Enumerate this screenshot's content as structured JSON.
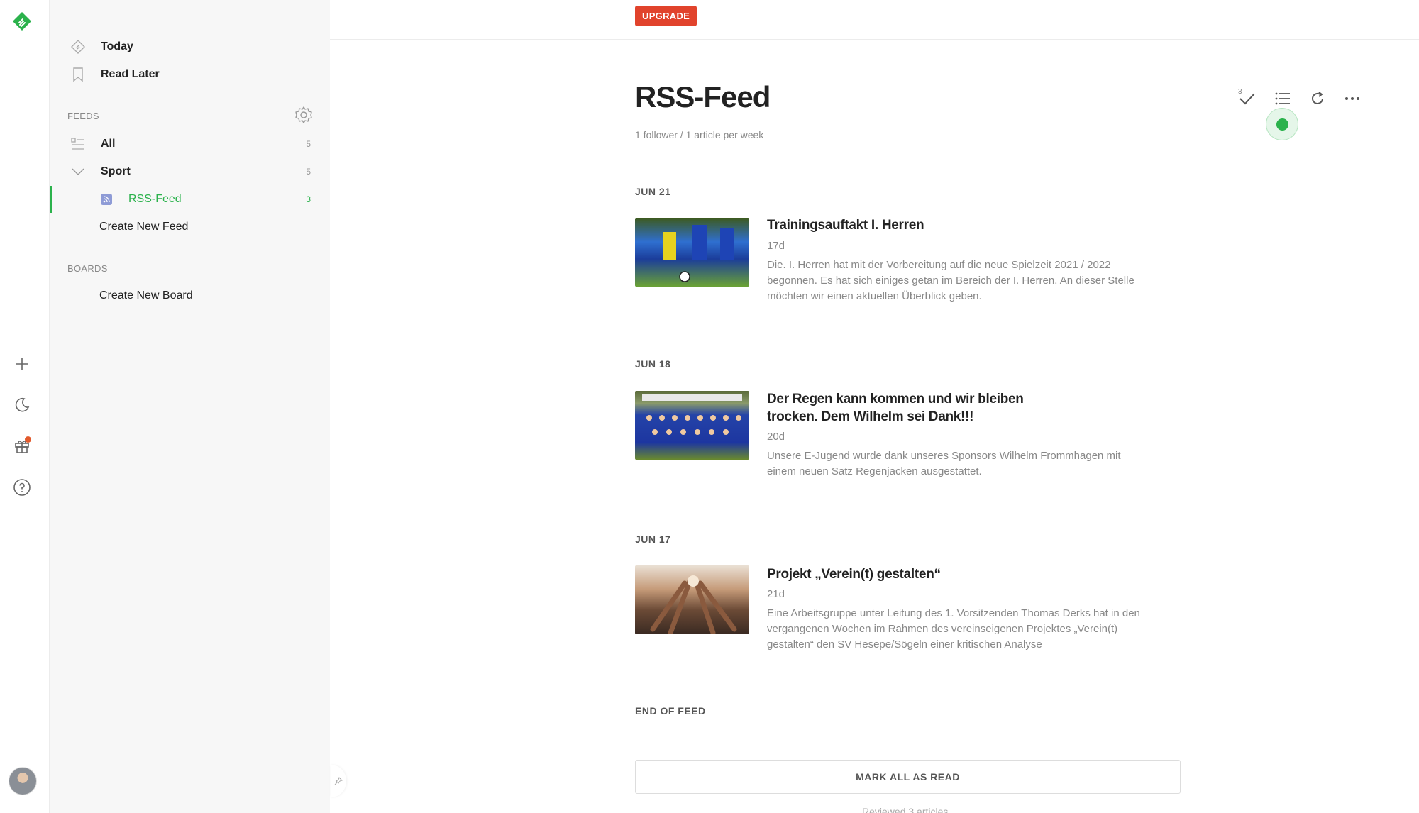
{
  "rail": {
    "icons": [
      "feedly-logo-icon",
      "plus-icon",
      "moon-icon",
      "gift-icon",
      "help-icon"
    ]
  },
  "sidebar": {
    "today": "Today",
    "read_later": "Read Later",
    "feeds_label": "FEEDS",
    "all": {
      "label": "All",
      "count": "5"
    },
    "sport": {
      "label": "Sport",
      "count": "5"
    },
    "rss_feed": {
      "label": "RSS-Feed",
      "count": "3"
    },
    "create_feed": "Create New Feed",
    "boards_label": "BOARDS",
    "create_board": "Create New Board"
  },
  "topbar": {
    "upgrade": "UPGRADE"
  },
  "feed": {
    "title": "RSS-Feed",
    "subtitle": "1 follower / 1 article per week",
    "mark_badge": "3"
  },
  "articles": [
    {
      "date": "JUN 21",
      "title": "Trainingsauftakt I. Herren",
      "age": "17d",
      "summary": "Die. I. Herren hat mit der Vorbereitung auf die neue Spielzeit 2021 / 2022 begonnen. Es hat sich einiges getan im Bereich der I. Herren. An dieser Stelle möchten wir einen aktuellen Überblick geben."
    },
    {
      "date": "JUN 18",
      "title": "Der Regen kann kommen und wir bleiben trocken. Dem Wilhelm sei Dank!!!",
      "age": "20d",
      "summary": "Unsere E-Jugend wurde dank unseres Sponsors Wilhelm Frommhagen mit einem neuen Satz Regenjacken ausgestattet."
    },
    {
      "date": "JUN 17",
      "title": "Projekt „Verein(t) gestalten“",
      "age": "21d",
      "summary": "Eine Arbeitsgruppe unter Leitung des 1. Vorsitzenden Thomas Derks hat in den vergangenen Wochen im Rahmen des vereinseigenen Projektes „Verein(t) gestalten“ den SV Hesepe/Sögeln einer kritischen Analyse"
    }
  ],
  "footer": {
    "end_of_feed": "END OF FEED",
    "mark_all": "MARK ALL AS READ",
    "reviewed": "Reviewed 3 articles"
  },
  "colors": {
    "accent": "#2bb24c",
    "upgrade": "#e1432c"
  }
}
